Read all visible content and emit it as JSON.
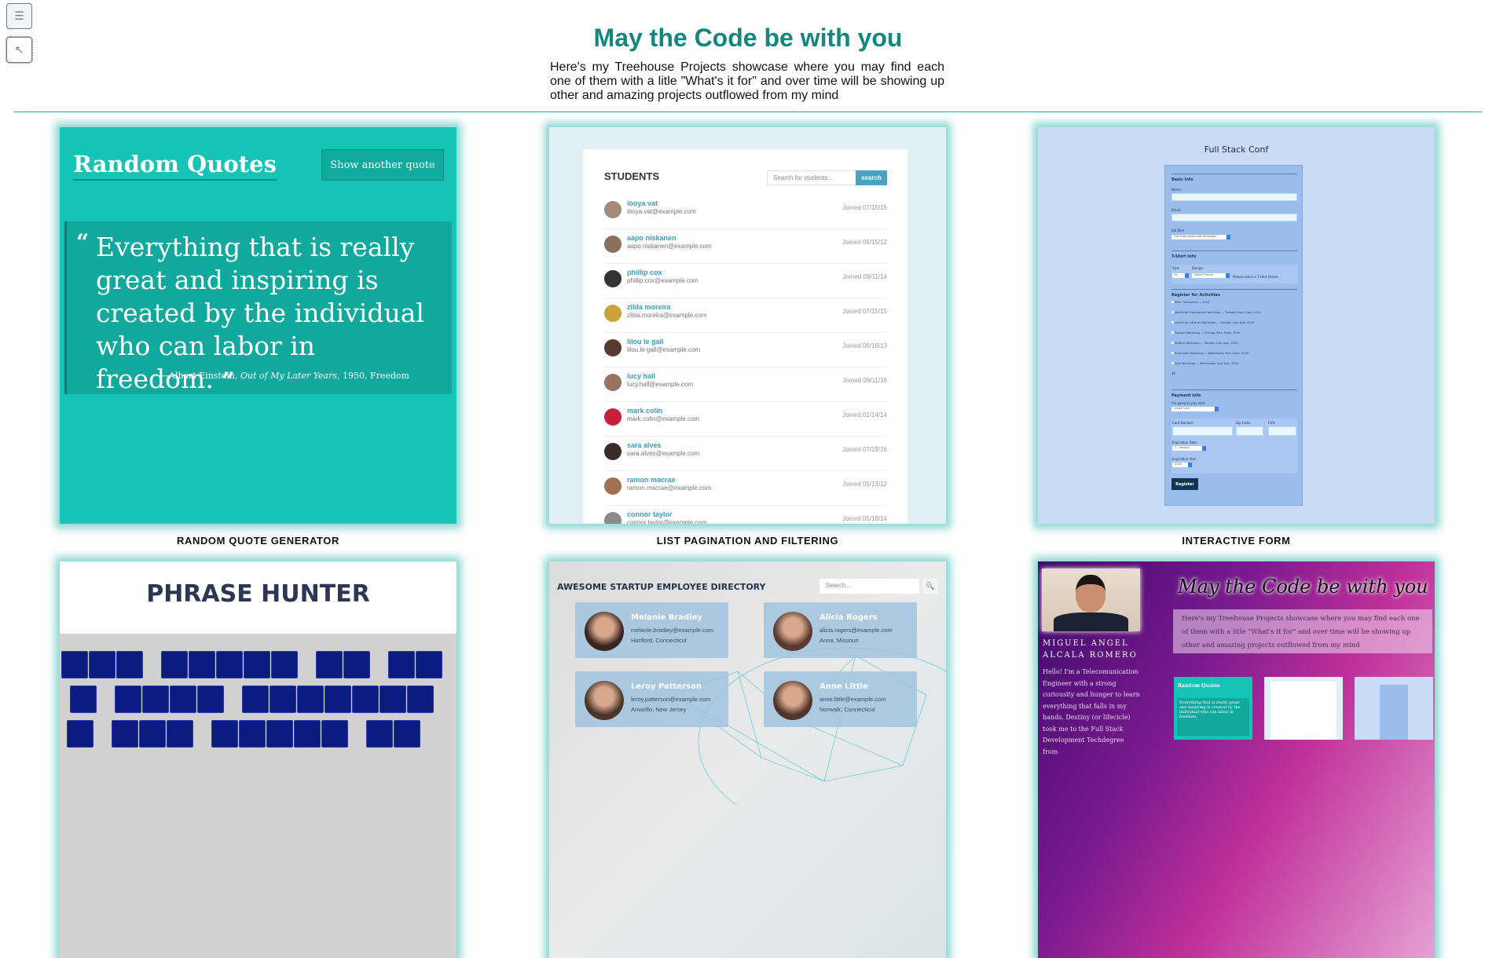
{
  "sidebar": {
    "menu_icon": "☰",
    "cursor_icon": "↖"
  },
  "header": {
    "title": "May the Code be with you",
    "intro": "Here's my Treehouse Projects showcase where you may find each one of them with a litle \"What's it for\" and over time will be showing up other and amazing projects outflowed from my mind"
  },
  "colors": {
    "accent": "#13877f",
    "glow": "#28b4aa"
  },
  "projects": [
    {
      "caption": "RANDOM QUOTE GENERATOR",
      "preview": {
        "title": "Random Quotes",
        "button": "Show another quote",
        "quote_open": "“",
        "quote": "Everything that is really great and inspiring is created by the individual who can labor in freedom.",
        "quote_close": "”",
        "source_prefix": "—Albert Einstein, ",
        "source_book": "Out of My Later Years",
        "source_suffix": ", 1950, Freedom"
      }
    },
    {
      "caption": "LIST PAGINATION AND FILTERING",
      "preview": {
        "heading": "STUDENTS",
        "search_placeholder": "Search for students...",
        "search_button": "search",
        "students": [
          {
            "name": "iboya vat",
            "email": "iboya.vat@example.com",
            "joined": "Joined 07/15/15",
            "color": "#a58a7a"
          },
          {
            "name": "aapo niskanen",
            "email": "aapo.niskanen@example.com",
            "joined": "Joined 06/15/12",
            "color": "#8b6f5c"
          },
          {
            "name": "phillip cox",
            "email": "phillip.cox@example.com",
            "joined": "Joined 09/11/14",
            "color": "#333333"
          },
          {
            "name": "zilda moreira",
            "email": "zilda.moreira@example.com",
            "joined": "Joined 07/15/15",
            "color": "#c9a23a"
          },
          {
            "name": "lilou le gall",
            "email": "lilou.le gall@example.com",
            "joined": "Joined 06/16/13",
            "color": "#5a3a30"
          },
          {
            "name": "lucy hall",
            "email": "lucy.hall@example.com",
            "joined": "Joined 09/11/16",
            "color": "#9a7360"
          },
          {
            "name": "mark colin",
            "email": "mark.colin@example.com",
            "joined": "Joined 01/14/14",
            "color": "#c8203a"
          },
          {
            "name": "sara alves",
            "email": "sara.alves@example.com",
            "joined": "Joined 07/19/16",
            "color": "#3a2a28"
          },
          {
            "name": "ramon macrae",
            "email": "ramon.macrae@example.com",
            "joined": "Joined 05/13/12",
            "color": "#a07050"
          },
          {
            "name": "connor taylor",
            "email": "connor.taylor@example.com",
            "joined": "Joined 05/18/14",
            "color": "#8a8a8a"
          }
        ]
      }
    },
    {
      "caption": "INTERACTIVE FORM",
      "preview": {
        "title": "Full Stack Conf",
        "basic_info": "Basic Info",
        "name_label": "Name:",
        "email_label": "Email:",
        "job_label": "Job Role",
        "job_value": "Full Stack JavaScript Developer",
        "tshirt_info": "T-Shirt Info",
        "size_label": "Size:",
        "size_value": "M",
        "design_label": "Design:",
        "design_value": "Select Theme",
        "theme_hint": "Please select a T-shirt theme.",
        "activities_title": "Register for Activities",
        "activities": [
          "Main Conference — $200",
          "JavaScript Frameworks Workshop — Tuesday 9am-12pm, $100",
          "JavaScript Libraries Workshop — Tuesday 1pm-4pm, $100",
          "Express Workshop — Tuesday 9am-12pm, $100",
          "Node.js Workshop — Tuesday 1pm-4pm, $100",
          "Build tools Workshop — Wednesday 9am-12pm, $100",
          "npm Workshop — Wednesday 1pm-4pm, $100"
        ],
        "total": "$0",
        "payment_info": "Payment Info",
        "pay_label": "I'm going to pay with:",
        "pay_value": "Credit Card",
        "card_label": "Card Number:",
        "zip_label": "Zip Code:",
        "cvv_label": "CVV:",
        "exp_date_label": "Expiration Date:",
        "exp_date_value": "1 - January",
        "exp_year_label": "Expiration Year:",
        "exp_year_value": "2016",
        "register": "Register"
      }
    },
    {
      "caption": "",
      "preview": {
        "title": "PHRASE HUNTER",
        "rows": [
          [
            3,
            5,
            2,
            2
          ],
          [
            1,
            4,
            7
          ],
          [
            1,
            3,
            5,
            2
          ]
        ]
      }
    },
    {
      "caption": "",
      "preview": {
        "title": "AWESOME STARTUP EMPLOYEE DIRECTORY",
        "search_placeholder": "Search...",
        "search_icon": "🔍",
        "employees": [
          {
            "name": "Melanie Bradley",
            "email": "melanie.bradley@example.com",
            "location": "Hartford, Connecticut",
            "color": "#3a2420"
          },
          {
            "name": "Alicia Rogers",
            "email": "alicia.rogers@example.com",
            "location": "Anna, Missouri",
            "color": "#5a3a32"
          },
          {
            "name": "Leroy Patterson",
            "email": "leroy.patterson@example.com",
            "location": "Amarillo, New Jersey",
            "color": "#4a3528"
          },
          {
            "name": "Anne Little",
            "email": "anne.little@example.com",
            "location": "Norwalk, Connecticut",
            "color": "#4e362c"
          }
        ]
      }
    },
    {
      "caption": "",
      "preview": {
        "name_line1": "MIGUEL ANGEL",
        "name_line2": "ALCALA ROMERO",
        "bio": "Hello! I'm a Telecomunication Engineer with a strong curiousity and hunger to learn everything that falls in my hands. Destiny (or lifecicle) took me to the Full Stack Development Techdegree from",
        "title": "May the Code be with you",
        "intro": "Here's my Treehouse Projects showcase where you may find each one of them with a litle \"What's it for\" and over time will be showing up other and amazing projects outflowed from my mind",
        "mini_quote_title": "Random Quotes",
        "mini_quote": "Everything that is really great and inspiring is created by the individual who can labor in freedom."
      }
    }
  ]
}
